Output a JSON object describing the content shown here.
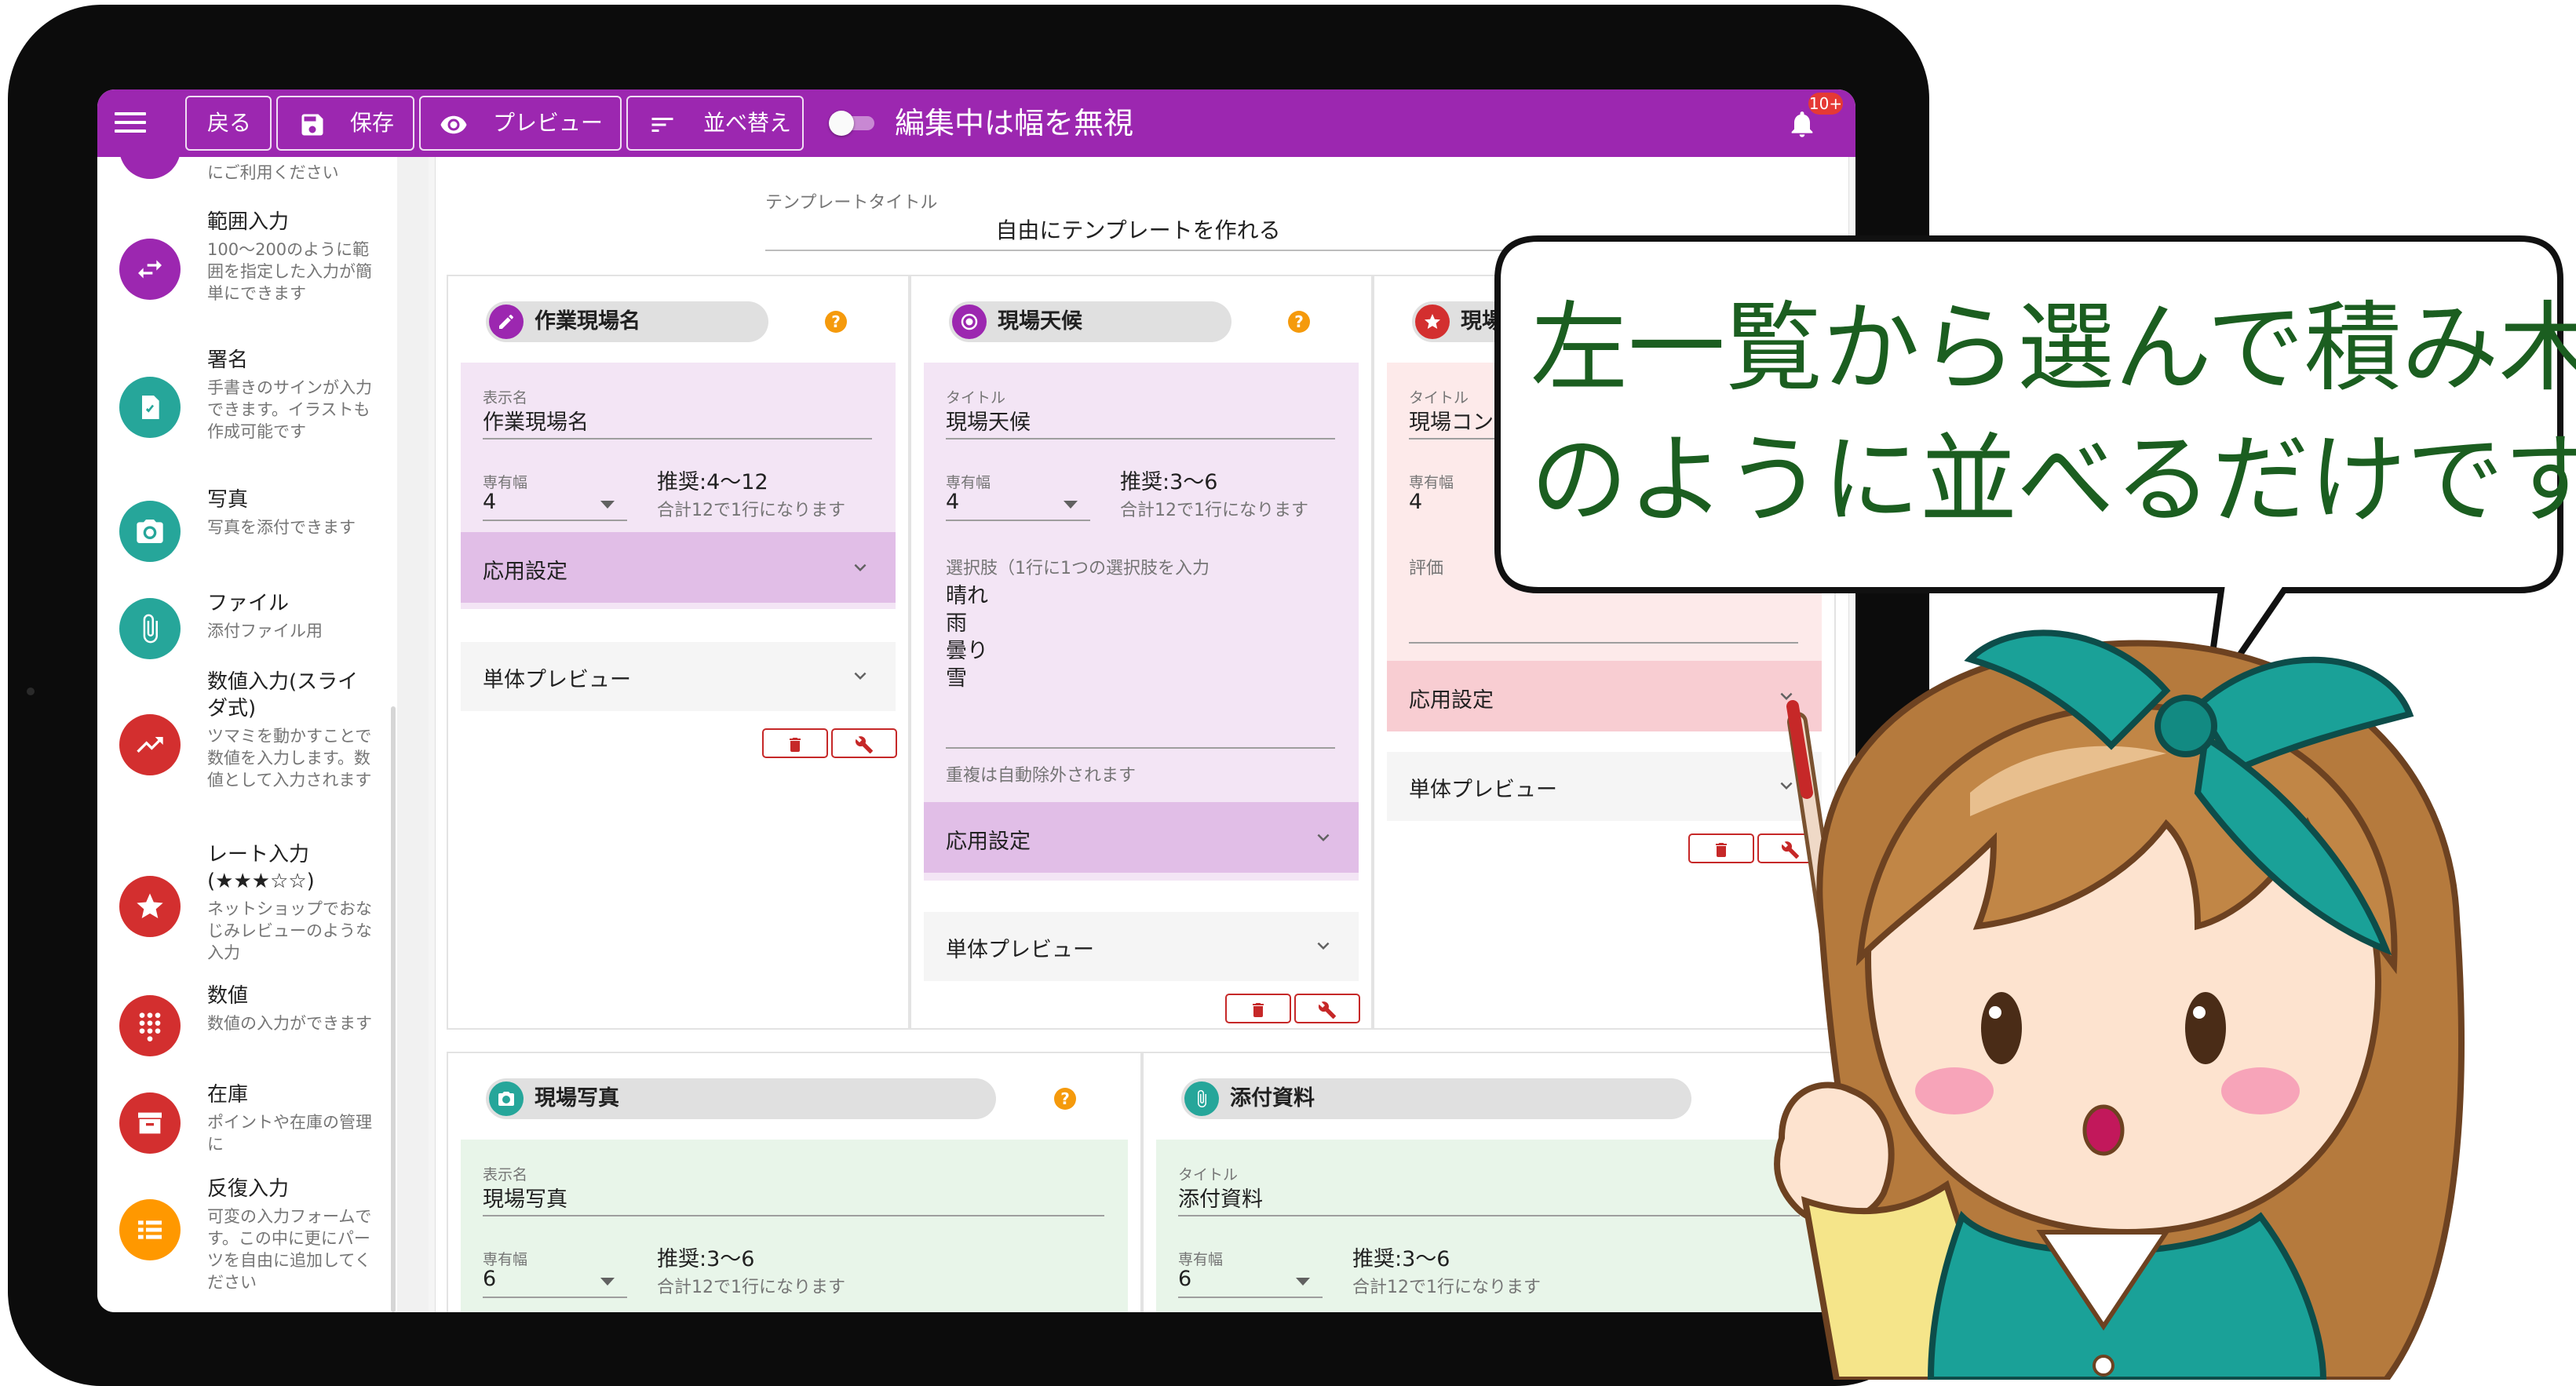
{
  "toolbar": {
    "back_label": "戻る",
    "save_label": "保存",
    "preview_label": "プレビュー",
    "sort_label": "並べ替え",
    "ignore_width_label": "編集中は幅を無視",
    "notification_badge": "10+",
    "color": "#9c27b0"
  },
  "sidebar": {
    "items": [
      {
        "title": "",
        "desc": "にご利用ください",
        "color": "#9c27b0",
        "icon": "partial-icon"
      },
      {
        "title": "範囲入力",
        "desc": "100～200のように範囲を指定した入力が簡単にできます",
        "color": "#9c27b0",
        "icon": "swap-arrows-icon"
      },
      {
        "title": "署名",
        "desc": "手書きのサインが入力できます。イラストも作成可能です",
        "color": "#26a69a",
        "icon": "signature-icon"
      },
      {
        "title": "写真",
        "desc": "写真を添付できます",
        "color": "#26a69a",
        "icon": "camera-icon"
      },
      {
        "title": "ファイル",
        "desc": "添付ファイル用",
        "color": "#26a69a",
        "icon": "paperclip-icon"
      },
      {
        "title": "数値入力(スライダ式)",
        "desc": "ツマミを動かすことで数値を入力します。数値として入力されます",
        "color": "#d32f2f",
        "icon": "trend-up-icon"
      },
      {
        "title": "レート入力(★★★☆☆)",
        "desc": "ネットショップでおなじみレビューのような入力",
        "color": "#d32f2f",
        "icon": "star-icon"
      },
      {
        "title": "数値",
        "desc": "数値の入力ができます",
        "color": "#d32f2f",
        "icon": "keypad-icon"
      },
      {
        "title": "在庫",
        "desc": "ポイントや在庫の管理に",
        "color": "#d32f2f",
        "icon": "archive-icon"
      },
      {
        "title": "反復入力",
        "desc": "可変の入力フォームです。この中に更にパーツを自由に追加してください",
        "color": "#ff9800",
        "icon": "list-icon"
      }
    ]
  },
  "template": {
    "label": "テンプレートタイトル",
    "value": "自由にテンプレートを作れる"
  },
  "cards": {
    "c1": {
      "title": "作業現場名",
      "field_label": "表示名",
      "field_value": "作業現場名",
      "width_label": "専有幅",
      "width_value": "4",
      "recommend": "推奨:4〜12",
      "hint": "合計12で1行になります",
      "advanced": "応用設定",
      "preview": "単体プレビュー"
    },
    "c2": {
      "title": "現場天候",
      "field_label": "タイトル",
      "field_value": "現場天候",
      "width_label": "専有幅",
      "width_value": "4",
      "recommend": "推奨:3〜6",
      "hint": "合計12で1行になります",
      "options_label": "選択肢（1行に1つの選択肢を入力",
      "options": [
        "晴れ",
        "雨",
        "曇り",
        "雪"
      ],
      "dedupe_hint": "重複は自動除外されます",
      "advanced": "応用設定",
      "preview": "単体プレビュー"
    },
    "c3": {
      "title": "現場コ",
      "field_label": "タイトル",
      "field_value": "現場コンデ",
      "width_label": "専有幅",
      "width_value": "4",
      "rating_label": "評価",
      "advanced": "応用設定",
      "preview": "単体プレビュー"
    },
    "c4": {
      "title": "現場写真",
      "field_label": "表示名",
      "field_value": "現場写真",
      "width_label": "専有幅",
      "width_value": "6",
      "recommend": "推奨:3〜6",
      "hint": "合計12で1行になります"
    },
    "c5": {
      "title": "添付資料",
      "field_label": "タイトル",
      "field_value": "添付資料",
      "width_label": "専有幅",
      "width_value": "6",
      "recommend": "推奨:3〜6",
      "hint": "合計12で1行になります"
    }
  },
  "callout": {
    "line1": "左一覧から選んで積み木",
    "line2": "のように並べるだけです"
  }
}
